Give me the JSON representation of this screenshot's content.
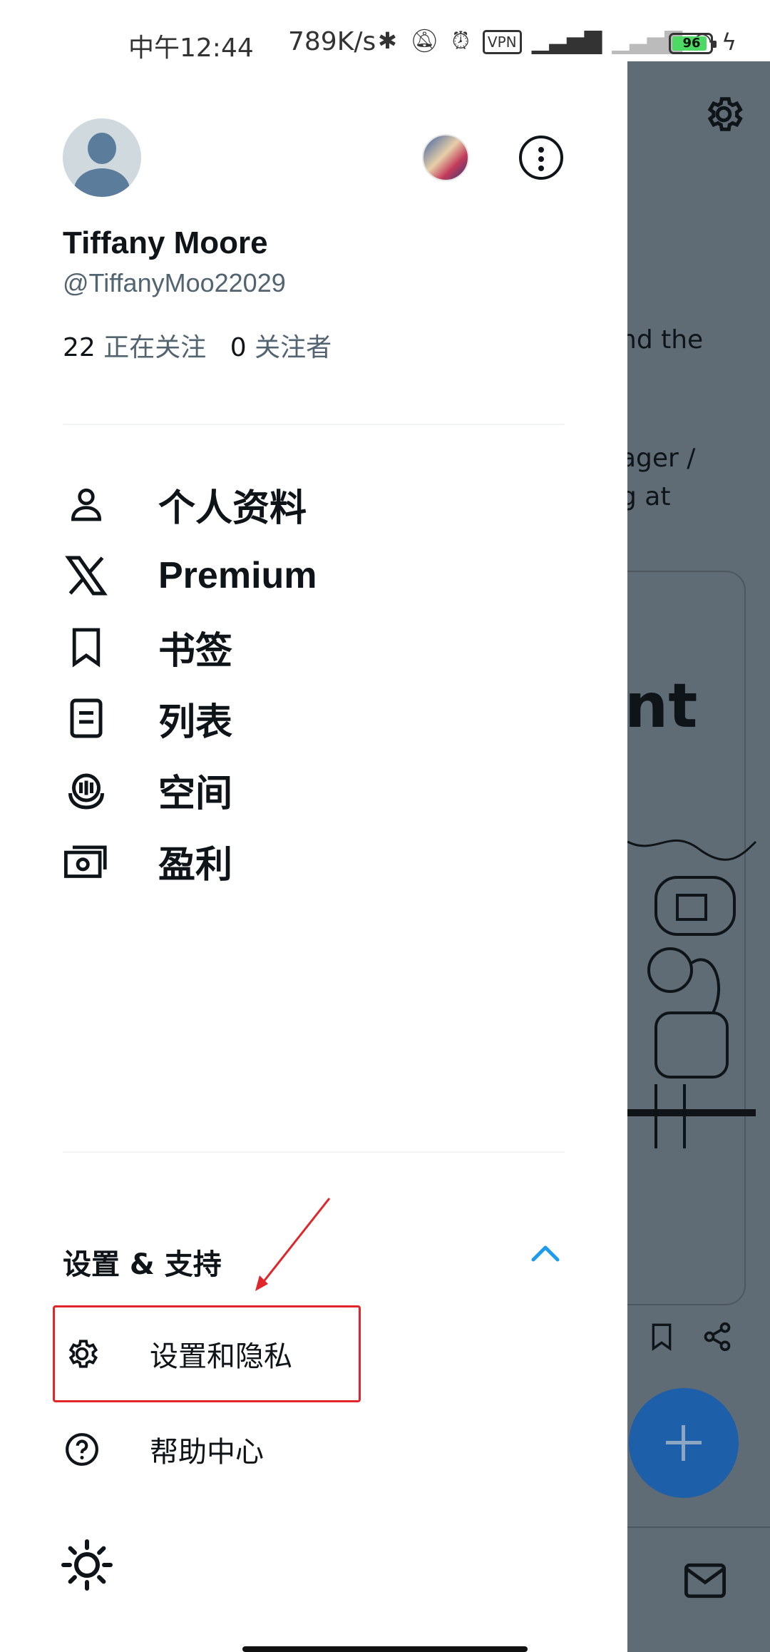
{
  "status_bar": {
    "time": "中午12:44",
    "network_speed": "789K/s",
    "vpn_label": "VPN",
    "battery": "96"
  },
  "profile": {
    "display_name": "Tiffany Moore",
    "handle": "@TiffanyMoo22029",
    "following_count": "22",
    "following_label": "正在关注",
    "followers_count": "0",
    "followers_label": "关注者"
  },
  "nav": {
    "items": [
      {
        "label": "个人资料",
        "icon": "person-icon"
      },
      {
        "label": "Premium",
        "icon": "x-logo-icon"
      },
      {
        "label": "书签",
        "icon": "bookmark-icon"
      },
      {
        "label": "列表",
        "icon": "list-icon"
      },
      {
        "label": "空间",
        "icon": "spaces-icon"
      },
      {
        "label": "盈利",
        "icon": "money-icon"
      }
    ]
  },
  "settings_section": {
    "title": "设置 & 支持",
    "items": [
      {
        "label": "设置和隐私",
        "icon": "gear-icon"
      },
      {
        "label": "帮助中心",
        "icon": "help-icon"
      }
    ]
  },
  "background": {
    "text_line_1": "nd the",
    "text_line_2": "ager /",
    "text_line_3": "g at",
    "card_heading": "nt"
  },
  "colors": {
    "accent": "#1d9bf0",
    "annotation": "#e0262b",
    "overlay": "#5f6b75"
  }
}
